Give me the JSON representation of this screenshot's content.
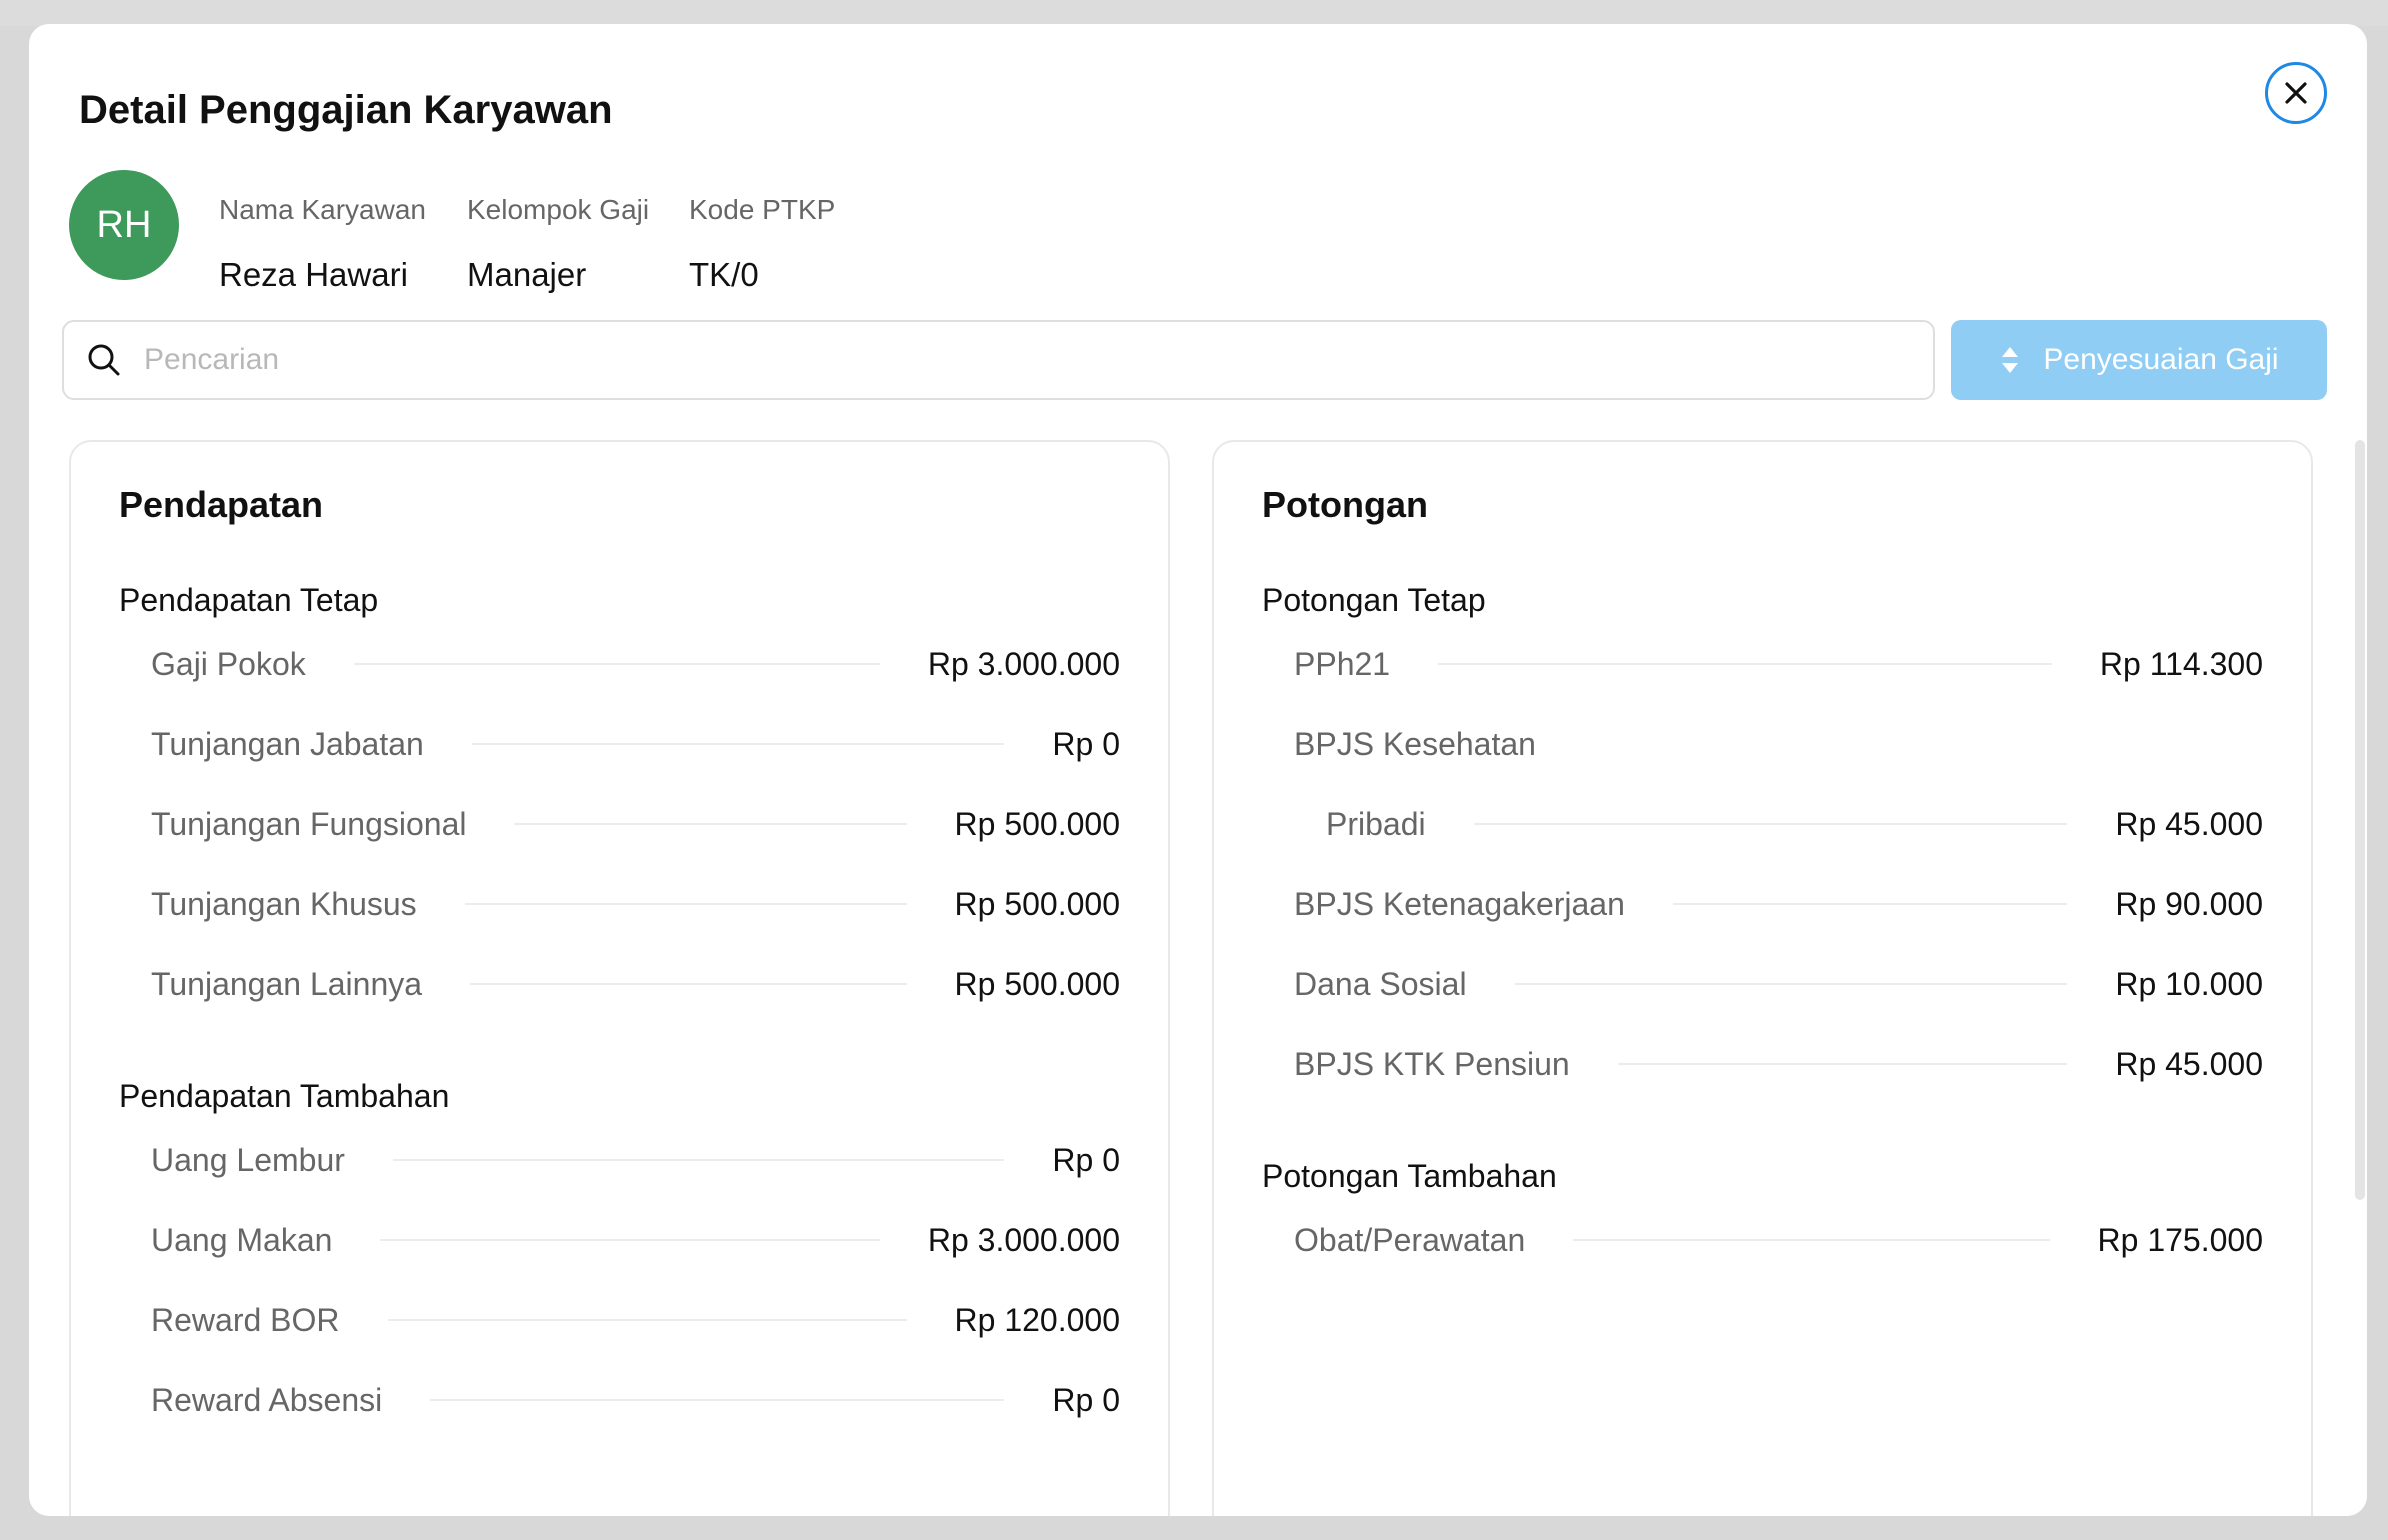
{
  "modal": {
    "title": "Detail Penggajian Karyawan"
  },
  "employee": {
    "initials": "RH",
    "name_label": "Nama Karyawan",
    "name": "Reza Hawari",
    "group_label": "Kelompok Gaji",
    "group": "Manajer",
    "ptkp_label": "Kode PTKP",
    "ptkp": "TK/0"
  },
  "search": {
    "placeholder": "Pencarian",
    "value": ""
  },
  "adjust_button": {
    "label": "Penyesuaian Gaji"
  },
  "income": {
    "title": "Pendapatan",
    "fixed": {
      "title": "Pendapatan Tetap",
      "items": [
        {
          "label": "Gaji Pokok",
          "value": "Rp 3.000.000"
        },
        {
          "label": "Tunjangan Jabatan",
          "value": "Rp 0"
        },
        {
          "label": "Tunjangan Fungsional",
          "value": "Rp 500.000"
        },
        {
          "label": "Tunjangan Khusus",
          "value": "Rp 500.000"
        },
        {
          "label": "Tunjangan Lainnya",
          "value": "Rp 500.000"
        }
      ]
    },
    "additional": {
      "title": "Pendapatan Tambahan",
      "items": [
        {
          "label": "Uang Lembur",
          "value": "Rp 0"
        },
        {
          "label": "Uang Makan",
          "value": "Rp 3.000.000"
        },
        {
          "label": "Reward BOR",
          "value": "Rp 120.000"
        },
        {
          "label": "Reward Absensi",
          "value": "Rp 0"
        }
      ]
    }
  },
  "deduction": {
    "title": "Potongan",
    "fixed": {
      "title": "Potongan Tetap",
      "pph21": {
        "label": "PPh21",
        "value": "Rp 114.300"
      },
      "bpjs_kesehatan": {
        "label": "BPJS Kesehatan"
      },
      "pribadi": {
        "label": "Pribadi",
        "value": "Rp 45.000"
      },
      "bpjs_tk": {
        "label": "BPJS Ketenagakerjaan",
        "value": "Rp 90.000"
      },
      "dana_sosial": {
        "label": "Dana Sosial",
        "value": "Rp 10.000"
      },
      "bpjs_pensiun": {
        "label": "BPJS KTK Pensiun",
        "value": "Rp 45.000"
      }
    },
    "additional": {
      "title": "Potongan Tambahan",
      "items": [
        {
          "label": "Obat/Perawatan",
          "value": "Rp 175.000"
        }
      ]
    }
  },
  "colors": {
    "accent": "#1e88e5",
    "avatar": "#3d9a5b",
    "button": "#90cdf4"
  },
  "icons": {
    "close": "close-icon",
    "search": "search-icon",
    "sort": "sort-icon"
  }
}
